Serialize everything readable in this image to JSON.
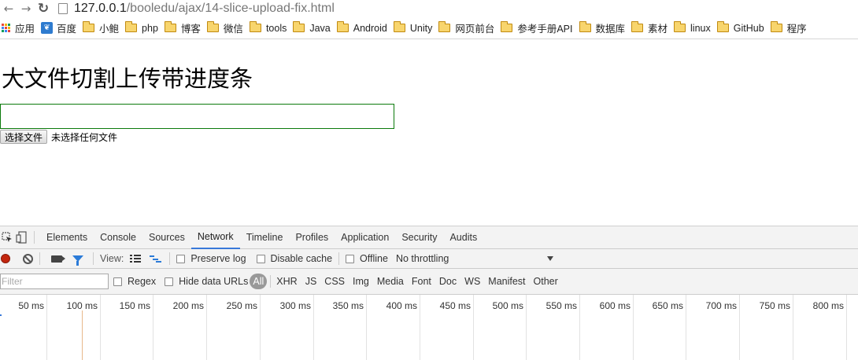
{
  "browser": {
    "url_host": "127.0.0.1",
    "url_path": "/booledu/ajax/14-slice-upload-fix.html",
    "bookmarks": [
      {
        "label": "应用",
        "icon": "apps-grid-icon"
      },
      {
        "label": "百度",
        "icon": "baidu-paw-icon"
      },
      {
        "label": "小鲍",
        "icon": "folder-icon"
      },
      {
        "label": "php",
        "icon": "folder-icon"
      },
      {
        "label": "博客",
        "icon": "folder-icon"
      },
      {
        "label": "微信",
        "icon": "folder-icon"
      },
      {
        "label": "tools",
        "icon": "folder-icon"
      },
      {
        "label": "Java",
        "icon": "folder-icon"
      },
      {
        "label": "Android",
        "icon": "folder-icon"
      },
      {
        "label": "Unity",
        "icon": "folder-icon"
      },
      {
        "label": "网页前台",
        "icon": "folder-icon"
      },
      {
        "label": "参考手册API",
        "icon": "folder-icon"
      },
      {
        "label": "数据库",
        "icon": "folder-icon"
      },
      {
        "label": "素材",
        "icon": "folder-icon"
      },
      {
        "label": "linux",
        "icon": "folder-icon"
      },
      {
        "label": "GitHub",
        "icon": "folder-icon"
      },
      {
        "label": "程序",
        "icon": "folder-icon"
      }
    ]
  },
  "page": {
    "title": "大文件切割上传带进度条",
    "progress_fraction": 0,
    "file_button_label": "选择文件",
    "file_status": "未选择任何文件"
  },
  "devtools": {
    "tabs": [
      "Elements",
      "Console",
      "Sources",
      "Network",
      "Timeline",
      "Profiles",
      "Application",
      "Security",
      "Audits"
    ],
    "active_tab": "Network",
    "toolbar": {
      "view_label": "View:",
      "preserve_log": "Preserve log",
      "disable_cache": "Disable cache",
      "offline": "Offline",
      "throttling": "No throttling"
    },
    "filter": {
      "placeholder": "Filter",
      "regex": "Regex",
      "hide_data_urls": "Hide data URLs",
      "types": [
        "All",
        "XHR",
        "JS",
        "CSS",
        "Img",
        "Media",
        "Font",
        "Doc",
        "WS",
        "Manifest",
        "Other"
      ]
    },
    "timeline_ticks": [
      "50 ms",
      "100 ms",
      "150 ms",
      "200 ms",
      "250 ms",
      "300 ms",
      "350 ms",
      "400 ms",
      "450 ms",
      "500 ms",
      "550 ms",
      "600 ms",
      "650 ms",
      "700 ms",
      "750 ms",
      "800 ms"
    ]
  },
  "colors": {
    "accent": "#3879d9",
    "record": "#c3260e",
    "progress_border": "#0c7a0c"
  }
}
